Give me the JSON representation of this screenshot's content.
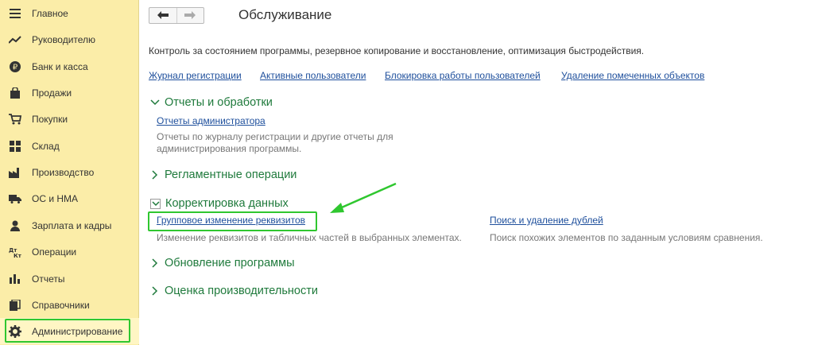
{
  "sidebar": {
    "items": [
      {
        "label": "Главное",
        "icon": "menu-icon"
      },
      {
        "label": "Руководителю",
        "icon": "trend-chart-icon"
      },
      {
        "label": "Банк и касса",
        "icon": "ruble-coin-icon"
      },
      {
        "label": "Продажи",
        "icon": "shopping-bag-icon"
      },
      {
        "label": "Покупки",
        "icon": "cart-icon"
      },
      {
        "label": "Склад",
        "icon": "warehouse-icon"
      },
      {
        "label": "Производство",
        "icon": "factory-icon"
      },
      {
        "label": "ОС и НМА",
        "icon": "truck-icon"
      },
      {
        "label": "Зарплата и кадры",
        "icon": "person-icon"
      },
      {
        "label": "Операции",
        "icon": "accounting-entry-icon"
      },
      {
        "label": "Отчеты",
        "icon": "bar-chart-icon"
      },
      {
        "label": "Справочники",
        "icon": "books-icon"
      },
      {
        "label": "Администрирование",
        "icon": "gear-icon"
      }
    ],
    "active_index": 12
  },
  "header": {
    "title": "Обслуживание",
    "back_icon": "arrow-left-icon",
    "forward_icon": "arrow-right-icon"
  },
  "description": "Контроль за состоянием программы, резервное копирование и восстановление, оптимизация быстродействия.",
  "top_links": [
    "Журнал регистрации",
    "Активные пользователи",
    "Блокировка работы пользователей",
    "Удаление помеченных объектов"
  ],
  "sections": {
    "reports": {
      "title": "Отчеты и обработки",
      "link": "Отчеты администратора",
      "desc_line1": "Отчеты по журналу регистрации и другие отчеты для",
      "desc_line2": "администрирования программы."
    },
    "routine": {
      "title": "Регламентные операции"
    },
    "correction": {
      "title": "Корректировка данных",
      "link1": "Групповое изменение реквизитов",
      "desc1": "Изменение реквизитов и табличных частей в выбранных элементах.",
      "link2": "Поиск и удаление дублей",
      "desc2": "Поиск похожих элементов по заданным условиям сравнения."
    },
    "update": {
      "title": "Обновление программы"
    },
    "performance": {
      "title": "Оценка производительности"
    }
  },
  "colors": {
    "sidebar_bg": "#fbeda8",
    "link": "#1e4f9c",
    "section_title": "#1f7a3c",
    "highlight": "#2fc72f"
  }
}
